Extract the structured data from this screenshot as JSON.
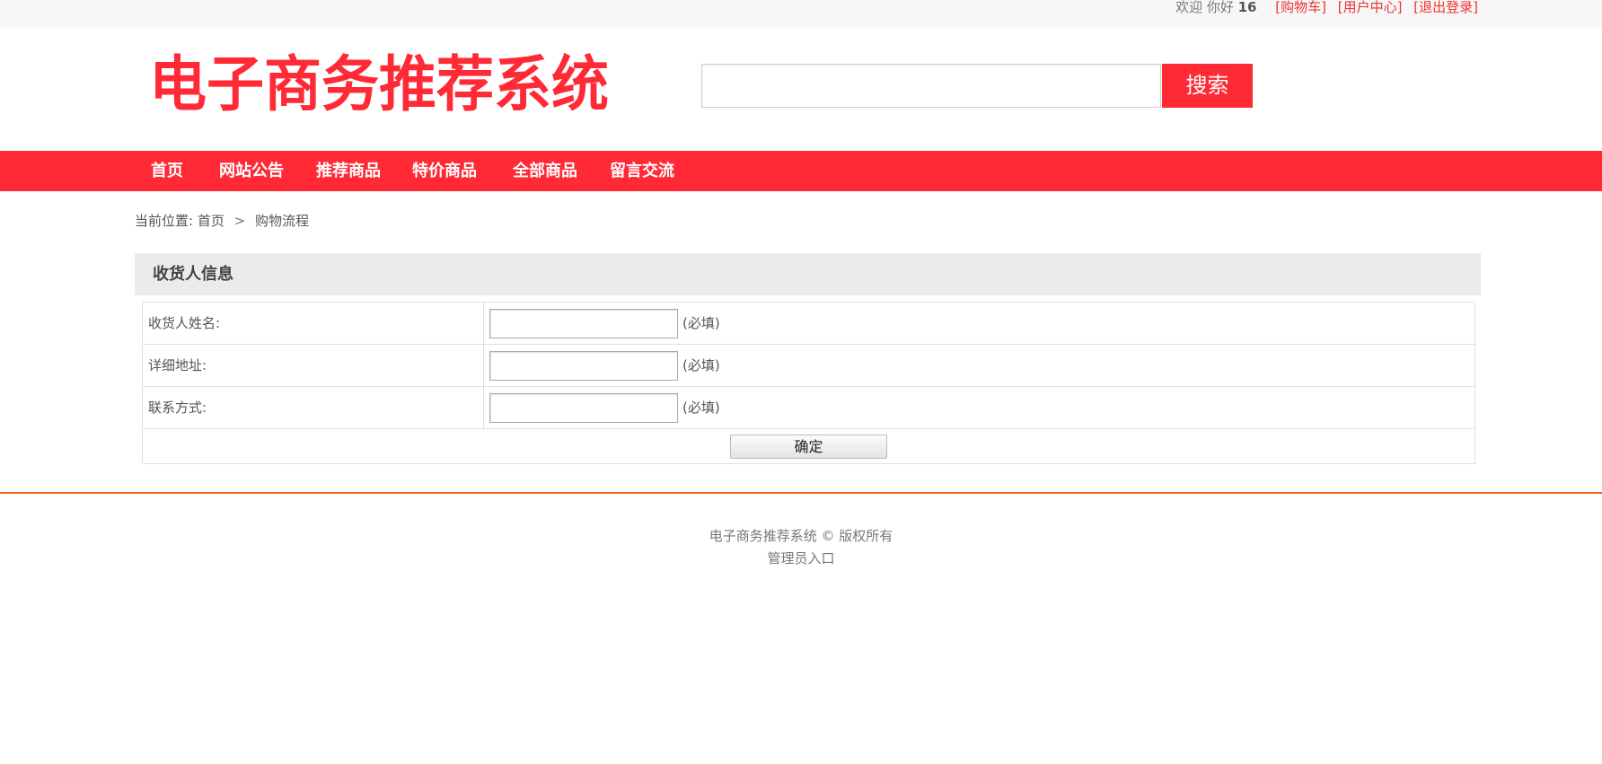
{
  "topbar": {
    "welcome": "欢迎 你好",
    "username": "16",
    "cart_link": "[购物车]",
    "user_center_link": "[用户中心]",
    "logout_link": "[退出登录]"
  },
  "header": {
    "logo_text": "电子商务推荐系统",
    "search_placeholder": "",
    "search_button": "搜索"
  },
  "nav": {
    "items": [
      "首页",
      "网站公告",
      "推荐商品",
      "特价商品",
      "全部商品",
      "留言交流"
    ]
  },
  "breadcrumb": {
    "prefix": "当前位置:",
    "home": "首页",
    "separator": ">",
    "current": "购物流程"
  },
  "form": {
    "title": "收货人信息",
    "fields": [
      {
        "label": "收货人姓名:",
        "value": "",
        "required_note": "(必填)"
      },
      {
        "label": "详细地址:",
        "value": "",
        "required_note": "(必填)"
      },
      {
        "label": "联系方式:",
        "value": "",
        "required_note": "(必填)"
      }
    ],
    "submit_label": "确定"
  },
  "footer": {
    "copyright": "电子商务推荐系统 © 版权所有",
    "admin_link": "管理员入口"
  },
  "colors": {
    "accent": "#ff2a36",
    "footer_line": "#e8661f",
    "topbar_bg": "#f7f7f7"
  }
}
